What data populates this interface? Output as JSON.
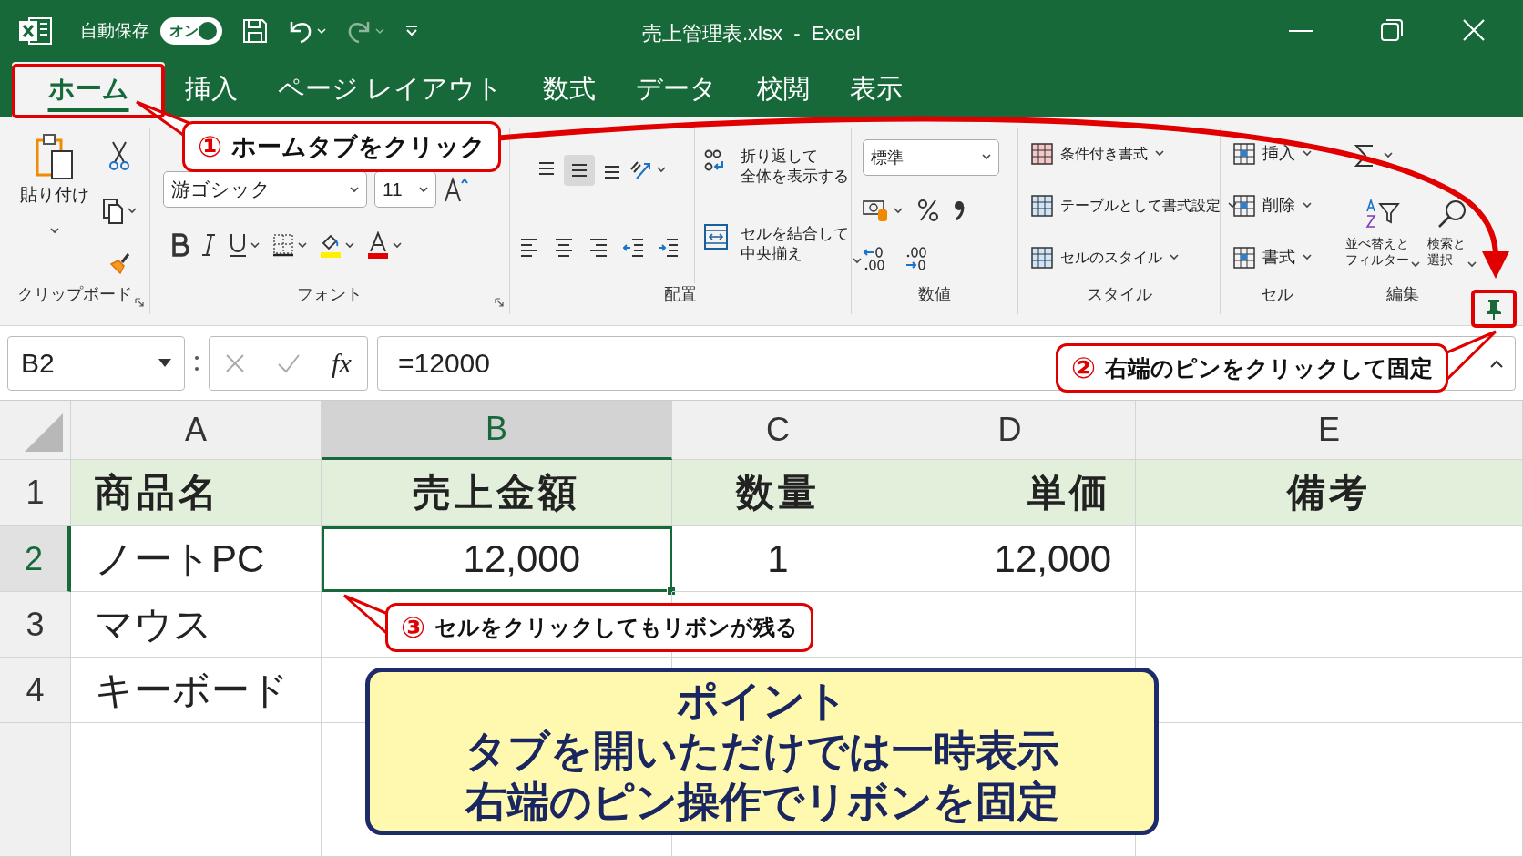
{
  "window": {
    "title": "売上管理表.xlsx  -  Excel"
  },
  "quick_access": {
    "autosave_label": "自動保存",
    "autosave_toggle": {
      "label": "オン",
      "on": true
    }
  },
  "tabs": [
    {
      "label": "ホーム",
      "selected": true
    },
    {
      "label": "挿入",
      "selected": false
    },
    {
      "label": "ページ レイアウト",
      "selected": false
    },
    {
      "label": "数式",
      "selected": false
    },
    {
      "label": "データ",
      "selected": false
    },
    {
      "label": "校閲",
      "selected": false
    },
    {
      "label": "表示",
      "selected": false
    }
  ],
  "ribbon": {
    "clipboard": {
      "label": "クリップボード",
      "paste": "貼り付け"
    },
    "font": {
      "label": "フォント",
      "font_name": "游ゴシック",
      "font_size": "11"
    },
    "alignment": {
      "label": "配置",
      "vertical_align": [
        {
          "selected": false
        },
        {
          "selected": true
        },
        {
          "selected": false
        }
      ],
      "wrap": [
        "折り返して",
        "全体を表示する"
      ],
      "merge": [
        "セルを結合して",
        "中央揃え"
      ]
    },
    "number": {
      "label": "数値",
      "format": "標準"
    },
    "styles": {
      "label": "スタイル",
      "items": [
        "条件付き書式",
        "テーブルとして書式設定",
        "セルのスタイル"
      ]
    },
    "cells": {
      "label": "セル",
      "items": [
        "挿入",
        "削除",
        "書式"
      ]
    },
    "editing": {
      "label": "編集",
      "sort": [
        "並べ替えと",
        "フィルター"
      ],
      "find": [
        "検索と",
        "選択"
      ]
    }
  },
  "formula_bar": {
    "name_box": "B2",
    "fx": "fx",
    "value": "=12000"
  },
  "sheet": {
    "columns": [
      {
        "label": "A",
        "selected": false
      },
      {
        "label": "B",
        "selected": true
      },
      {
        "label": "C",
        "selected": false
      },
      {
        "label": "D",
        "selected": false
      },
      {
        "label": "E",
        "selected": false
      }
    ],
    "rows": [
      {
        "number": "1",
        "selected": false,
        "shaded": true,
        "cells": [
          "商品名",
          "売上金額",
          "数量",
          "単価",
          "備考"
        ]
      },
      {
        "number": "2",
        "selected": true,
        "shaded": false,
        "cells": [
          "ノートPC",
          "12,000",
          "1",
          "12,000"
        ]
      },
      {
        "number": "3",
        "selected": false,
        "shaded": false,
        "cells": [
          "マウス"
        ]
      },
      {
        "number": "4",
        "selected": false,
        "shaded": false,
        "cells": [
          "キーボード"
        ]
      }
    ]
  },
  "annotations": [
    {
      "number": "①",
      "text": "ホームタブをクリック"
    },
    {
      "number": "②",
      "text": "右端のピンをクリックして固定"
    },
    {
      "number": "③",
      "text": "セルをクリックしてもリボンが残る"
    }
  ],
  "point": {
    "title": "ポイント",
    "lines": [
      "タブを開いただけでは一時表示",
      "右端のピン操作でリボンを固定"
    ]
  }
}
